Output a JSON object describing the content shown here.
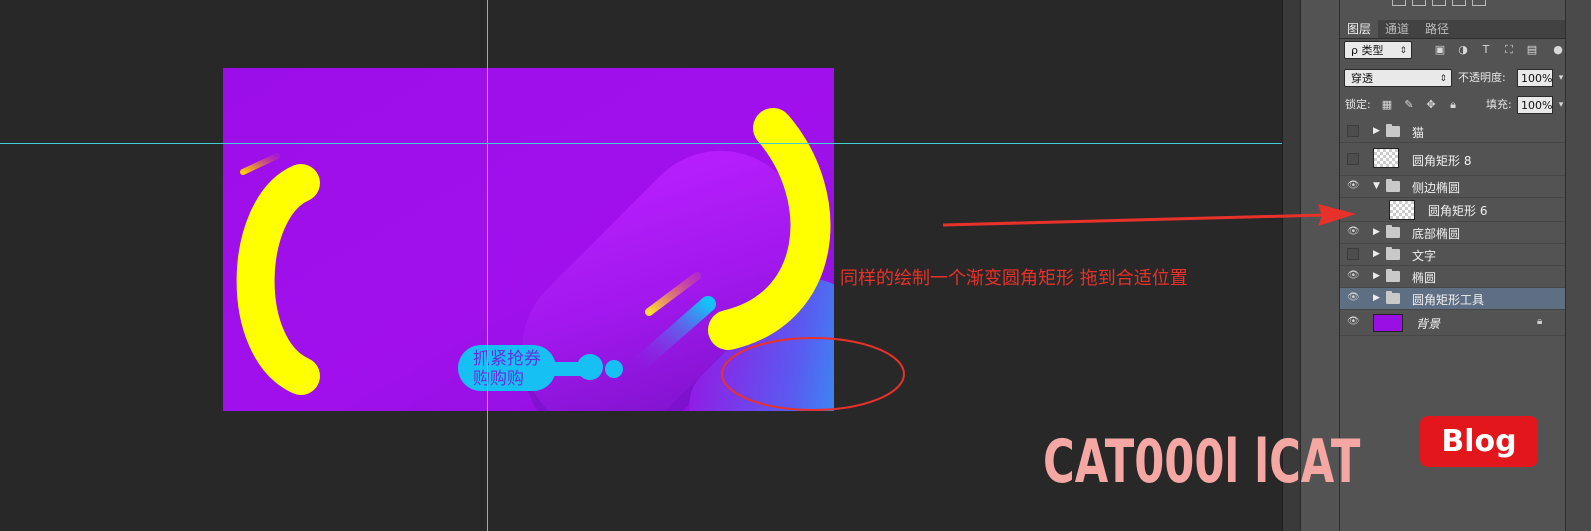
{
  "canvas": {
    "tag_line1": "抓紧抢券",
    "tag_line2": "购购购"
  },
  "annotation": {
    "text": "同样的绘制一个渐变圆角矩形 拖到合适位置"
  },
  "panel": {
    "tabs": [
      "图层",
      "通道",
      "路径"
    ],
    "filter_kind": "ρ 类型",
    "blend_mode": "穿透",
    "opacity_label": "不透明度:",
    "opacity_value": "100%",
    "lock_label": "锁定:",
    "fill_label": "填充:",
    "fill_value": "100%",
    "layers": [
      {
        "name": "猫",
        "type": "group",
        "visible": false,
        "expanded": false
      },
      {
        "name": "圆角矩形 8",
        "type": "shape",
        "visible": false
      },
      {
        "name": "侧边椭圆",
        "type": "group",
        "visible": true,
        "expanded": true
      },
      {
        "name": "圆角矩形 6",
        "type": "shape",
        "visible": false,
        "indented": true
      },
      {
        "name": "底部椭圆",
        "type": "group",
        "visible": true,
        "expanded": false
      },
      {
        "name": "文字",
        "type": "group",
        "visible": false,
        "expanded": false
      },
      {
        "name": "椭圆",
        "type": "group",
        "visible": true,
        "expanded": false
      },
      {
        "name": "圆角矩形工具",
        "type": "group",
        "visible": true,
        "expanded": false,
        "selected": true
      },
      {
        "name": "背景",
        "type": "background",
        "visible": true,
        "locked": true
      }
    ]
  },
  "watermark": {
    "text": "CAT000l lCAT",
    "badge": "Blog"
  },
  "colors": {
    "canvas_purple": "#9a10e4",
    "accent_yellow": "#ffff00",
    "accent_cyan": "#13c3f5",
    "annotation_red": "#e8312a",
    "guide_cyan": "#3fd0d6"
  }
}
